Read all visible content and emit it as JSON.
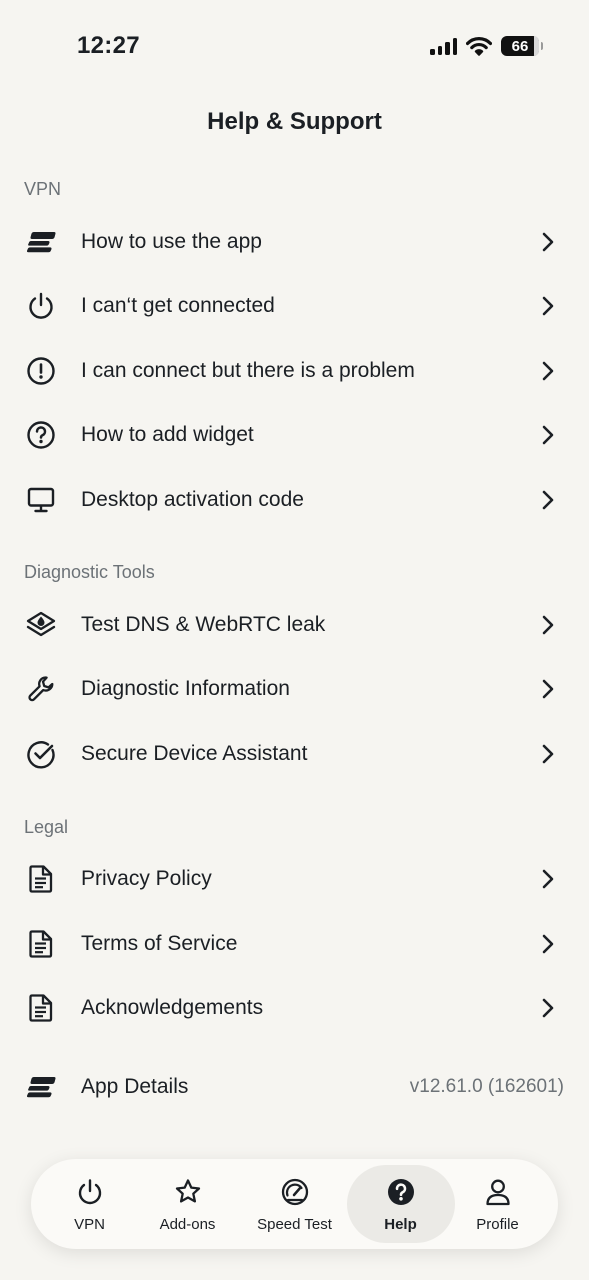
{
  "status_bar": {
    "time": "12:27",
    "battery_level": "66"
  },
  "header": {
    "title": "Help & Support"
  },
  "sections": [
    {
      "title": "VPN",
      "items": [
        {
          "label": "How to use the app",
          "icon": "expressvpn-logo-icon"
        },
        {
          "label": "I can‘t get connected",
          "icon": "power-icon"
        },
        {
          "label": "I can connect but there is a problem",
          "icon": "exclamation-circle-icon"
        },
        {
          "label": "How to add widget",
          "icon": "question-circle-icon"
        },
        {
          "label": "Desktop activation code",
          "icon": "monitor-icon"
        }
      ]
    },
    {
      "title": "Diagnostic Tools",
      "items": [
        {
          "label": "Test DNS & WebRTC leak",
          "icon": "layers-droplet-icon"
        },
        {
          "label": "Diagnostic Information",
          "icon": "wrench-icon"
        },
        {
          "label": "Secure Device Assistant",
          "icon": "check-circle-icon"
        }
      ]
    },
    {
      "title": "Legal",
      "items": [
        {
          "label": "Privacy Policy",
          "icon": "document-icon"
        },
        {
          "label": "Terms of Service",
          "icon": "document-icon"
        },
        {
          "label": "Acknowledgements",
          "icon": "document-icon"
        }
      ]
    }
  ],
  "app_details": {
    "label": "App Details",
    "version": "v12.61.0 (162601)",
    "icon": "expressvpn-logo-icon"
  },
  "tabbar": {
    "active": "Help",
    "tabs": [
      {
        "label": "VPN",
        "icon": "power-icon"
      },
      {
        "label": "Add-ons",
        "icon": "star-icon"
      },
      {
        "label": "Speed Test",
        "icon": "speedometer-icon"
      },
      {
        "label": "Help",
        "icon": "question-filled-icon"
      },
      {
        "label": "Profile",
        "icon": "person-icon"
      }
    ]
  }
}
